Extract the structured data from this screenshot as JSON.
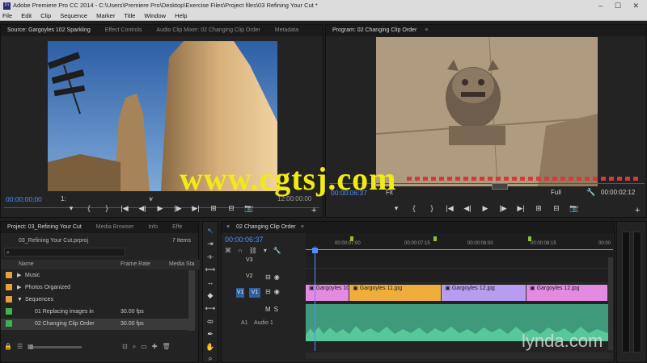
{
  "window": {
    "title": "Adobe Premiere Pro CC 2014 - C:\\Users\\Premiere Pro\\Desktop\\Exercise Files\\Project files\\03 Refining Your Cut *",
    "controls": "–  ☐  ✕"
  },
  "menu": [
    "File",
    "Edit",
    "Clip",
    "Sequence",
    "Marker",
    "Title",
    "Window",
    "Help"
  ],
  "source": {
    "tabs": [
      "Source: Gargoyles 102 Sparkling",
      "Effect Controls",
      "Audio Clip Mixer: 02 Changing Clip Order",
      "Metadata"
    ],
    "timecode_left": "00;00;00;00",
    "fit": "1:",
    "timecode_right": "12:00:00:00",
    "controls": [
      "▾",
      "{",
      "}",
      "|◀",
      "◀|",
      "▶",
      "|▶",
      "▶|",
      "⊞",
      "⊟",
      "📷"
    ]
  },
  "program": {
    "tab": "Program: 02 Changing Clip Order",
    "timecode_left": "00:00:06:37",
    "fit": "Fit",
    "quality": "Full",
    "timecode_right": "00:00:02:12",
    "controls": [
      "▾",
      "{",
      "}",
      "|◀",
      "◀|",
      "▶",
      "|▶",
      "▶|",
      "⊞",
      "⊟",
      "📷"
    ]
  },
  "project": {
    "tabs": [
      "Project: 03_Refining Your Cut",
      "Media Browser",
      "Info",
      "Effe"
    ],
    "path": "03_Refining Your Cut.prproj",
    "count": "7 Items",
    "columns": [
      "Name",
      "Frame Rate",
      "Media Sta"
    ],
    "rows": [
      {
        "name": "Music",
        "rate": "",
        "color": "#e5a23a",
        "indent": 0,
        "arrow": "▶"
      },
      {
        "name": "Photos Organized",
        "rate": "",
        "color": "#e5a23a",
        "indent": 0,
        "arrow": "▶"
      },
      {
        "name": "Sequences",
        "rate": "",
        "color": "#e5a23a",
        "indent": 0,
        "arrow": "▼"
      },
      {
        "name": "01 Replacing images in",
        "rate": "30.00 fps",
        "color": "#3fb34f",
        "indent": 1,
        "arrow": ""
      },
      {
        "name": "02 Changing Clip Order",
        "rate": "30.00 fps",
        "color": "#3fb34f",
        "indent": 1,
        "arrow": ""
      }
    ]
  },
  "timeline": {
    "tab": "02 Changing Clip Order",
    "timecode": "00:00:06:37",
    "ruler": [
      "00:00:07:00",
      "00:00:07:15",
      "00:00:08:00",
      "00:00:08:15",
      "00:00"
    ],
    "tracks": {
      "v3": "V3",
      "v2": "V2",
      "v1": "V1",
      "a1_source": "V1",
      "a1": "A1",
      "a1_name": "Audio 1"
    },
    "clips": [
      {
        "name": "Gargoyles 10.jpg",
        "color": "#e38be0",
        "start": 0.0,
        "end": 0.145
      },
      {
        "name": "Gargoyles 11.jpg",
        "color": "#f0ad3c",
        "start": 0.145,
        "end": 0.45
      },
      {
        "name": "Gargoyles 12.jpg",
        "color": "#b79cf0",
        "start": 0.45,
        "end": 0.73
      },
      {
        "name": "Gargoyles 12.jpg",
        "color": "#e38be0",
        "start": 0.73,
        "end": 1.0
      }
    ]
  },
  "watermarks": {
    "cgtsj": "www.cgtsj.com",
    "lynda": "lynda.com"
  }
}
